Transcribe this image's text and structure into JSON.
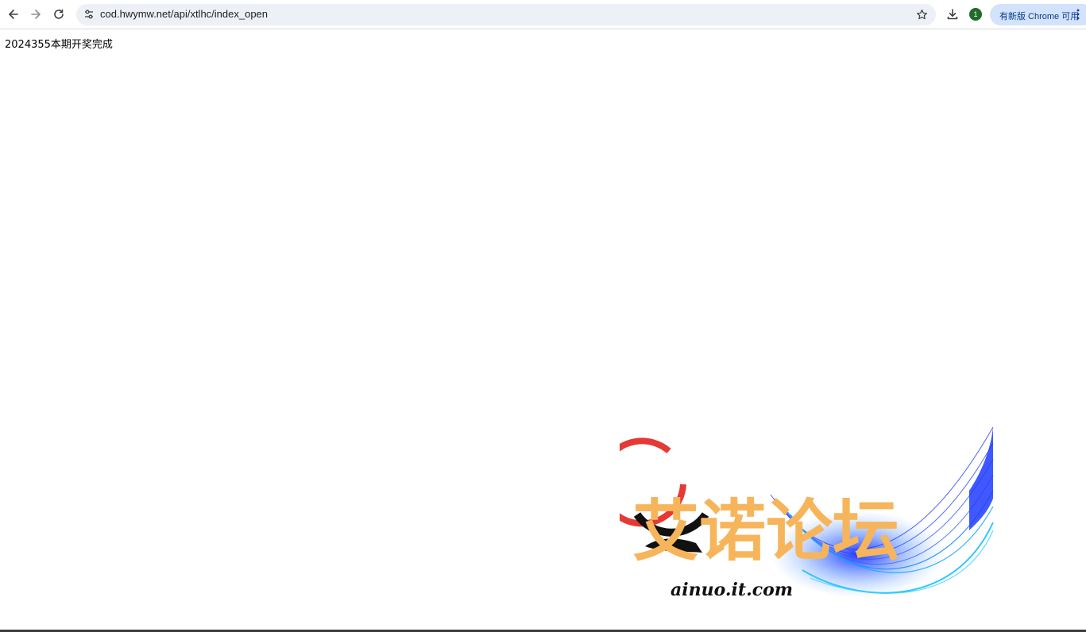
{
  "browser": {
    "url": "cod.hwymw.net/api/xtlhc/index_open",
    "profile_badge": "1",
    "update_label": "有新版 Chrome 可用",
    "icons": {
      "back": "arrow-left-icon",
      "forward": "arrow-right-icon",
      "reload": "reload-icon",
      "site_info": "tune-icon",
      "bookmark": "star-icon",
      "download": "download-icon",
      "menu": "more-vert-icon"
    }
  },
  "page": {
    "result_text": "2024355本期开奖完成"
  },
  "watermark": {
    "logo_text": "艾诺论坛",
    "logo_url": "ainuo.it.com",
    "colors": {
      "text": "#f7b55b",
      "ring_red": "#e53935",
      "ring_black": "#111111",
      "wave_blue": "#1f3cff"
    }
  }
}
